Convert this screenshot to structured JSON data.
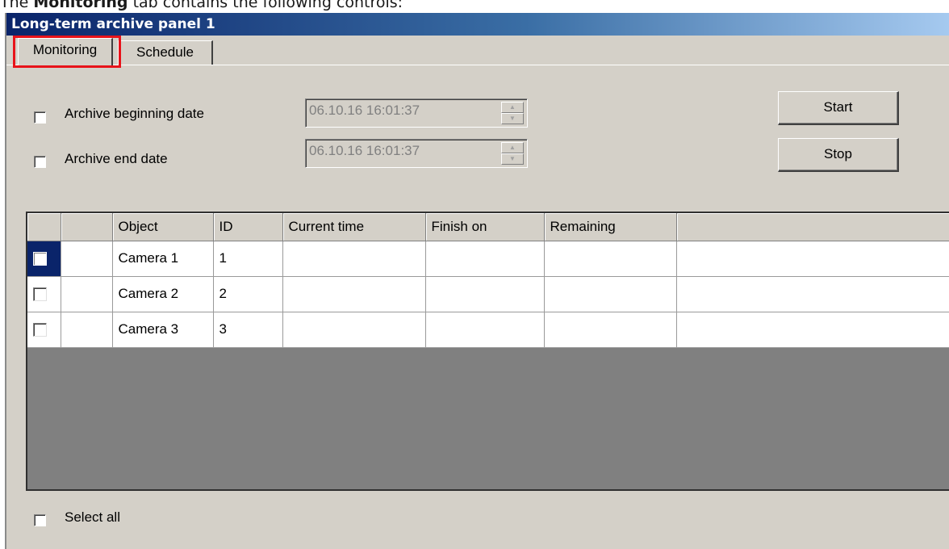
{
  "caption": {
    "prefix": "The ",
    "bold": "Monitoring",
    "suffix": " tab contains the following controls:"
  },
  "window": {
    "title": "Long-term archive panel 1"
  },
  "tabs": [
    {
      "label": "Monitoring",
      "active": true
    },
    {
      "label": "Schedule",
      "active": false
    }
  ],
  "filters": {
    "begin": {
      "label": "Archive beginning date",
      "checked": false,
      "value": "06.10.16 16:01:37"
    },
    "end": {
      "label": "Archive end date",
      "checked": false,
      "value": "06.10.16 16:01:37"
    }
  },
  "buttons": {
    "start": "Start",
    "stop": "Stop"
  },
  "table": {
    "columns": [
      "",
      "",
      "Object",
      "ID",
      "Current time",
      "Finish on",
      "Remaining",
      ""
    ],
    "rows": [
      {
        "selected": true,
        "checked": false,
        "object": "Camera 1",
        "id": "1",
        "current_time": "",
        "finish_on": "",
        "remaining": ""
      },
      {
        "selected": false,
        "checked": false,
        "object": "Camera 2",
        "id": "2",
        "current_time": "",
        "finish_on": "",
        "remaining": ""
      },
      {
        "selected": false,
        "checked": false,
        "object": "Camera 3",
        "id": "3",
        "current_time": "",
        "finish_on": "",
        "remaining": ""
      }
    ]
  },
  "select_all": {
    "label": "Select all",
    "checked": false
  },
  "colors": {
    "highlight_border": "#e8131a",
    "selection": "#0a246a",
    "face": "#d4d0c8"
  }
}
